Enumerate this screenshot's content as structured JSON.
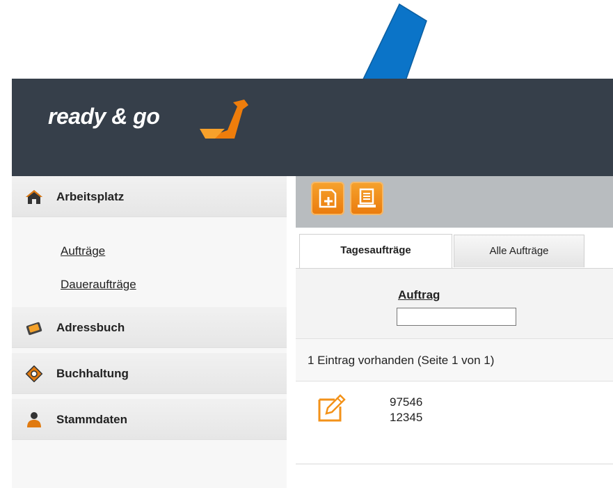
{
  "colors": {
    "header_bg": "#363f4a",
    "accent_orange": "#f39219",
    "arrow_blue": "#0b74c8",
    "toolbar_bg": "#b8bcbf"
  },
  "annotation": {
    "icon": "arrow-icon"
  },
  "header": {
    "logo_text": "ready & go"
  },
  "sidebar": {
    "sections": [
      {
        "label": "Arbeitsplatz",
        "icon": "home-icon"
      },
      {
        "label": "Adressbuch",
        "icon": "address-book-icon"
      },
      {
        "label": "Buchhaltung",
        "icon": "accounting-icon"
      },
      {
        "label": "Stammdaten",
        "icon": "user-icon"
      }
    ],
    "arbeitsplatz_items": [
      {
        "label": "Aufträge"
      },
      {
        "label": "Daueraufträge"
      }
    ]
  },
  "toolbar": {
    "buttons": [
      {
        "icon": "new-document-icon"
      },
      {
        "icon": "list-document-icon"
      }
    ]
  },
  "tabs": [
    {
      "label": "Tagesaufträge",
      "active": true
    },
    {
      "label": "Alle Aufträge",
      "active": false
    }
  ],
  "filter": {
    "column_label": "Auftrag",
    "input_value": ""
  },
  "status": {
    "count_text": "1 Eintrag vorhanden (Seite 1 von 1)"
  },
  "rows": [
    {
      "line1": "97546",
      "line2": "12345",
      "icon": "edit-icon"
    }
  ]
}
